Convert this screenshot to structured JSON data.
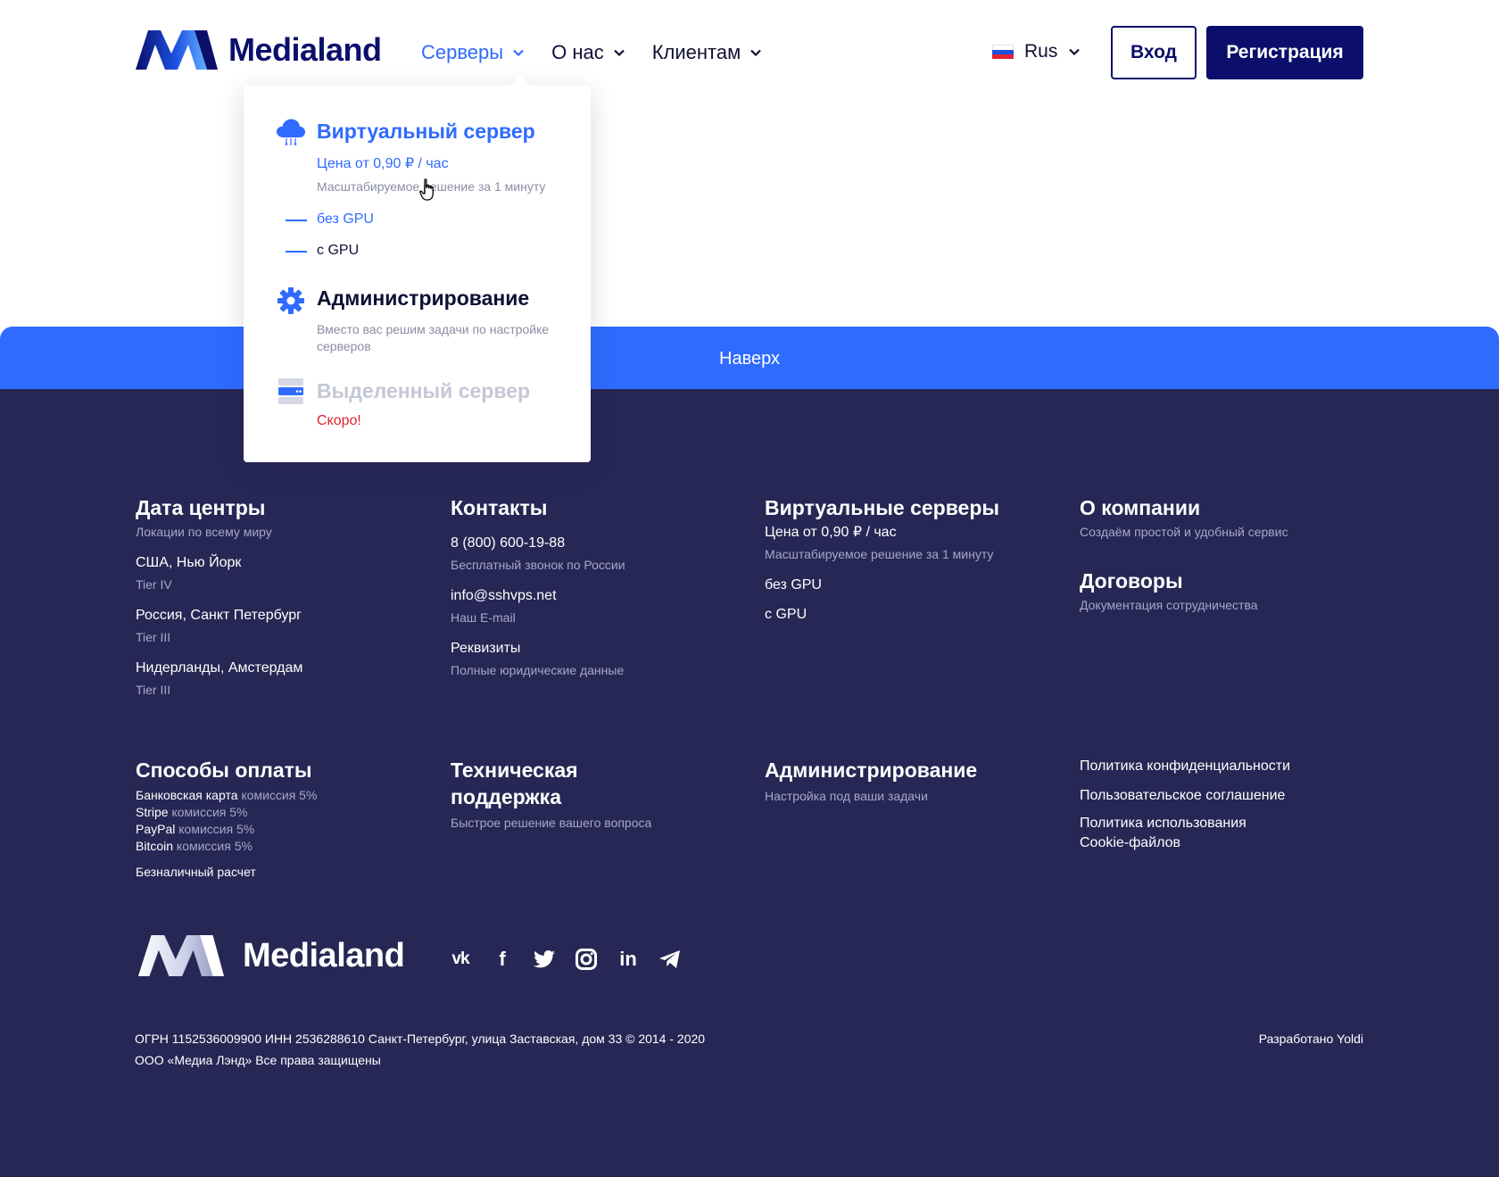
{
  "header": {
    "brand": "Medialand",
    "nav": [
      {
        "label": "Серверы",
        "active": true
      },
      {
        "label": "О нас",
        "active": false
      },
      {
        "label": "Клиентам",
        "active": false
      }
    ],
    "language": "Rus",
    "login_label": "Вход",
    "register_label": "Регистрация"
  },
  "dropdown": {
    "virtual": {
      "title": "Виртуальный сервер",
      "price": "Цена от 0,90 ₽ / час",
      "desc": "Масштабируемое решение за 1 минуту",
      "options": [
        "без GPU",
        "с GPU"
      ]
    },
    "admin": {
      "title": "Администрирование",
      "desc": "Вместо вас решим задачи по настройке серверов"
    },
    "dedicated": {
      "title": "Выделенный сервер",
      "soon": "Скоро!"
    }
  },
  "topbar": {
    "label": "Наверх"
  },
  "footer": {
    "datacenters": {
      "title": "Дата центры",
      "subtitle": "Локации по всему миру",
      "items": [
        {
          "name": "США, Нью Йорк",
          "tier": "Tier IV"
        },
        {
          "name": "Россия, Санкт Петербург",
          "tier": "Tier III"
        },
        {
          "name": "Нидерланды, Амстердам",
          "tier": "Tier III"
        }
      ]
    },
    "contacts": {
      "title": "Контакты",
      "items": [
        {
          "value": "8 (800) 600-19-88",
          "note": "Бесплатный звонок по России"
        },
        {
          "value": "info@sshvps.net",
          "note": "Наш E-mail"
        },
        {
          "value": "Реквизиты",
          "note": "Полные юридические данные"
        }
      ]
    },
    "virtual": {
      "title": "Виртуальные серверы",
      "price": "Цена от 0,90 ₽ / час",
      "desc": "Масштабируемое решение за 1 минуту",
      "options": [
        "без GPU",
        "с GPU"
      ]
    },
    "company": {
      "title": "О компании",
      "subtitle": "Создаём простой и удобный сервис",
      "contracts_title": "Договоры",
      "contracts_subtitle": "Документация сотрудничества"
    },
    "payment": {
      "title": "Способы оплаты",
      "methods": [
        {
          "name": "Банковская карта",
          "fee": "комиссия 5%"
        },
        {
          "name": "Stripe",
          "fee": "комиссия 5%"
        },
        {
          "name": "PayPal",
          "fee": "комиссия 5%"
        },
        {
          "name": "Bitcoin",
          "fee": "комиссия 5%"
        }
      ],
      "cashless": "Безналичный расчет"
    },
    "support": {
      "title_line1": "Техническая",
      "title_line2": "поддержка",
      "subtitle": "Быстрое решение вашего вопроса"
    },
    "admin": {
      "title": "Администрирование",
      "subtitle": "Настройка под ваши задачи"
    },
    "policies": {
      "privacy": "Политика конфиденциальности",
      "agreement": "Пользовательское соглашение",
      "cookie_line1": "Политика использования",
      "cookie_line2": "Cookie-файлов"
    },
    "brand": "Medialand",
    "social": [
      {
        "icon": "vk-icon",
        "glyph": "vk"
      },
      {
        "icon": "facebook-icon",
        "glyph": "f"
      },
      {
        "icon": "twitter-icon",
        "glyph": ""
      },
      {
        "icon": "instagram-icon",
        "glyph": ""
      },
      {
        "icon": "linkedin-icon",
        "glyph": "in"
      },
      {
        "icon": "telegram-icon",
        "glyph": ""
      }
    ],
    "legal_line1": "ОГРН 1152536009900 ИНН 2536288610 Санкт-Петербург, улица Заставская, дом 33 © 2014 - 2020",
    "legal_line2": "ООО «Медиа Лэнд» Все права защищены",
    "developer": "Разработано Yoldi"
  },
  "colors": {
    "brand_navy": "#0b0f6b",
    "accent_blue": "#2f6bff",
    "footer_bg": "#272755",
    "soon_red": "#e5222e"
  }
}
